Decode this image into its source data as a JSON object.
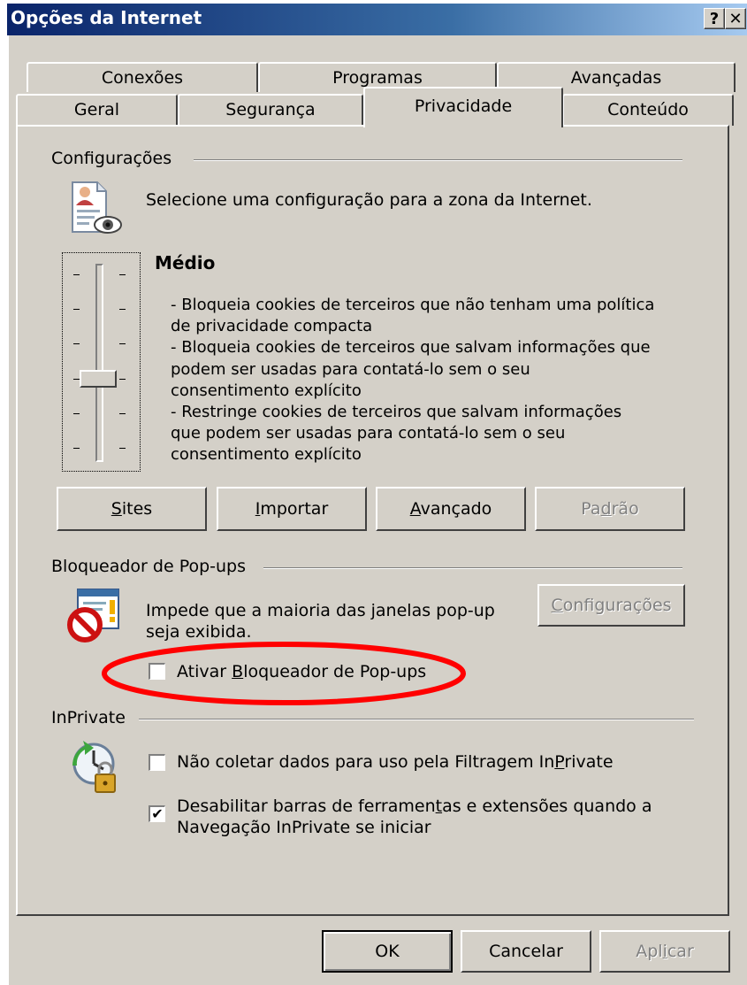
{
  "window": {
    "title": "Opções da Internet",
    "help_btn": "?",
    "close_btn": "✕"
  },
  "tabs": {
    "row_top": [
      "Conexões",
      "Programas",
      "Avançadas"
    ],
    "row_bottom": [
      "Geral",
      "Segurança",
      "Privacidade",
      "Conteúdo"
    ],
    "active": "Privacidade"
  },
  "settings": {
    "group_label": "Configurações",
    "intro": "Selecione uma configuração para a zona da Internet.",
    "level_title": "Médio",
    "level_desc": [
      "- Bloqueia cookies de terceiros que não tenham uma política",
      "de privacidade compacta",
      "- Bloqueia cookies de terceiros que salvam informações que",
      "podem ser usadas para contatá-lo sem o seu",
      "consentimento explícito",
      "- Restringe cookies de terceiros que salvam informações",
      "que podem ser usadas para contatá-lo sem o seu",
      "consentimento explícito"
    ],
    "slider_level": 0.6,
    "buttons": {
      "sites_u": "S",
      "sites_rest": "ites",
      "import_u": "I",
      "import_rest": "mportar",
      "advanced_u": "A",
      "advanced_rest": "vançado",
      "default_pre": "Pa",
      "default_u": "d",
      "default_rest": "rão"
    }
  },
  "popup": {
    "group_label": "Bloqueador de Pop-ups",
    "desc_line1": "Impede que a maioria das janelas pop-up",
    "desc_line2": "seja exibida.",
    "config_u": "C",
    "config_rest": "onfigurações",
    "enable_pre": "Ativar ",
    "enable_u": "B",
    "enable_rest": "loqueador de Pop-ups",
    "enable_checked": false,
    "highlight_color": "#ff0000"
  },
  "inprivate": {
    "group_label": "InPrivate",
    "filter_pre": "Não coletar dados para uso pela Filtragem In",
    "filter_u": "P",
    "filter_rest": "rivate",
    "filter_checked": false,
    "toolbars_line1_pre": "Desabilitar barras de ferramen",
    "toolbars_line1_u": "t",
    "toolbars_line1_rest": "as e extensões quando a",
    "toolbars_line2": "Navegação InPrivate se iniciar",
    "toolbars_checked": true,
    "check_glyph": "✔"
  },
  "footer": {
    "ok": "OK",
    "cancel": "Cancelar",
    "apply_pre": "Apl",
    "apply_u": "i",
    "apply_rest": "car"
  },
  "colors": {
    "face": "#d4d0c8",
    "title_start": "#0a246a",
    "title_end": "#a6caf0"
  }
}
